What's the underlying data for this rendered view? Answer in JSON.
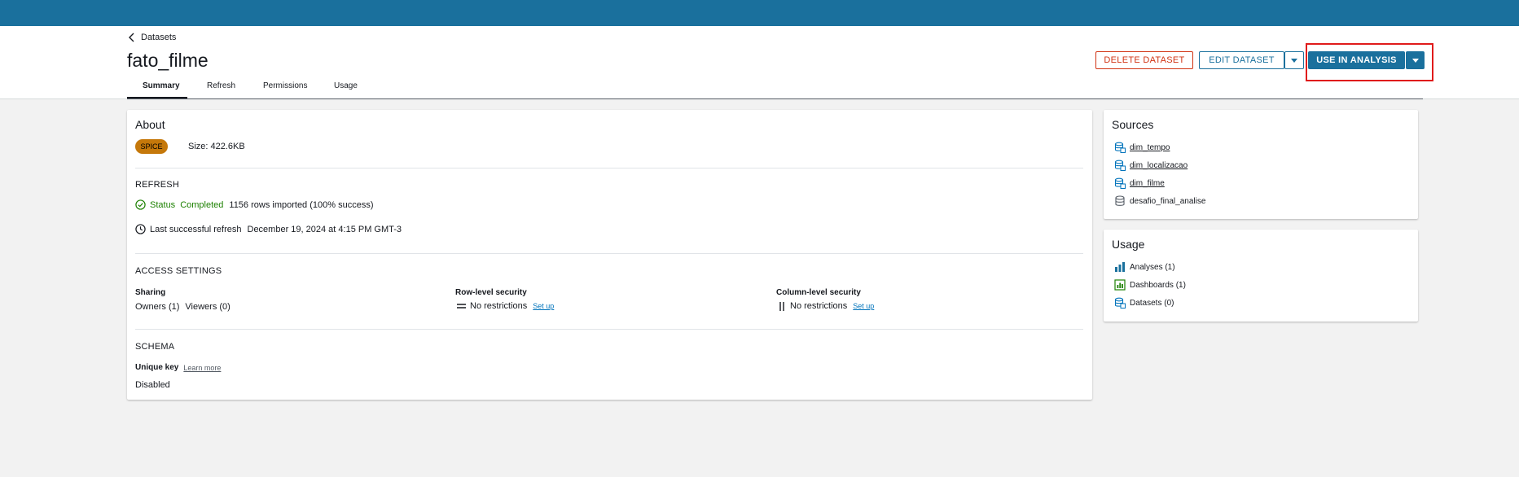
{
  "breadcrumb": {
    "label": "Datasets"
  },
  "page": {
    "title": "fato_filme"
  },
  "tabs": [
    {
      "label": "Summary"
    },
    {
      "label": "Refresh"
    },
    {
      "label": "Permissions"
    },
    {
      "label": "Usage"
    }
  ],
  "actions": {
    "delete_label": "DELETE DATASET",
    "edit_label": "EDIT DATASET",
    "use_label": "USE IN ANALYSIS"
  },
  "about": {
    "title": "About",
    "badge": "SPICE",
    "size": "Size: 422.6KB",
    "refresh": {
      "header": "REFRESH",
      "status_label": "Status",
      "status_value": "Completed",
      "rows_text": "1156 rows imported (100% success)",
      "last_label": "Last successful refresh",
      "last_value": "December 19, 2024 at 4:15 PM GMT-3"
    },
    "access": {
      "header": "ACCESS SETTINGS",
      "sharing_label": "Sharing",
      "owners": "Owners (1)",
      "viewers": "Viewers (0)",
      "rls_label": "Row-level security",
      "rls_value": "No restrictions",
      "rls_link": "Set up",
      "cls_label": "Column-level security",
      "cls_value": "No restrictions",
      "cls_link": "Set up"
    },
    "schema": {
      "header": "SCHEMA",
      "unique_key_label": "Unique key",
      "learn_more": "Learn more",
      "unique_key_value": "Disabled"
    }
  },
  "sources": {
    "title": "Sources",
    "items": [
      {
        "label": "dim_tempo",
        "icon": "dataset-icon"
      },
      {
        "label": "dim_localizacao",
        "icon": "dataset-icon"
      },
      {
        "label": "dim_filme",
        "icon": "dataset-icon"
      },
      {
        "label": "desafio_final_analise",
        "icon": "database-icon"
      }
    ]
  },
  "usage": {
    "title": "Usage",
    "items": [
      {
        "label": "Analyses (1)",
        "icon": "analysis-icon"
      },
      {
        "label": "Dashboards (1)",
        "icon": "dashboard-icon"
      },
      {
        "label": "Datasets (0)",
        "icon": "dataset-icon"
      }
    ]
  },
  "colors": {
    "brand": "#1a709d",
    "danger": "#d13212",
    "success": "#1d8102",
    "spice": "#c5780a",
    "highlight": "#e01b1b"
  }
}
